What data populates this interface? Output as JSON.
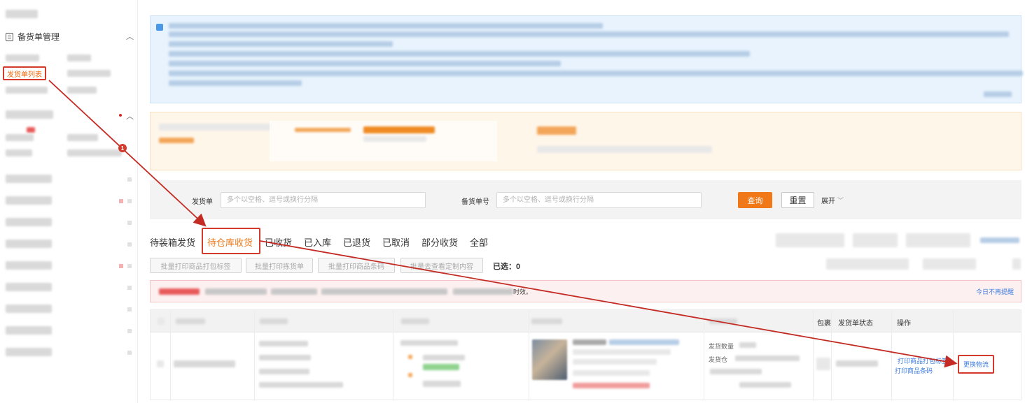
{
  "sidebar": {
    "group_title": "备货单管理",
    "active_item_label": "发货单列表"
  },
  "filter": {
    "shipment_label": "发货单",
    "shipment_placeholder": "多个以空格、逗号或换行分隔",
    "stock_label": "备货单号",
    "stock_placeholder": "多个以空格、逗号或换行分隔",
    "query_label": "查询",
    "reset_label": "重置",
    "expand_label": "展开"
  },
  "tabs": [
    "待装箱发货",
    "待仓库收货",
    "已收货",
    "已入库",
    "已退货",
    "已取消",
    "部分收货",
    "全部"
  ],
  "active_tab": "待仓库收货",
  "actions": {
    "btn1": "批量打印商品打包标签",
    "btn2": "批量打印拣货单",
    "btn3": "批量打印商品条码",
    "btn4": "批量去查看定制内容",
    "selected_label": "已选：0"
  },
  "alert": {
    "tail_text": "时效。",
    "dismiss_label": "今日不再提醒"
  },
  "table": {
    "headers": {
      "package": "包裹",
      "status": "发货单状态",
      "operation": "操作"
    },
    "row": {
      "ship_qty_label": "发货数量",
      "ship_warehouse_label": "发货仓",
      "print_label_link": "打印商品打包标签",
      "print_barcode_link": "打印商品条码",
      "change_logistics_link": "更换物流"
    }
  },
  "annotation": {
    "step_number": "1"
  }
}
